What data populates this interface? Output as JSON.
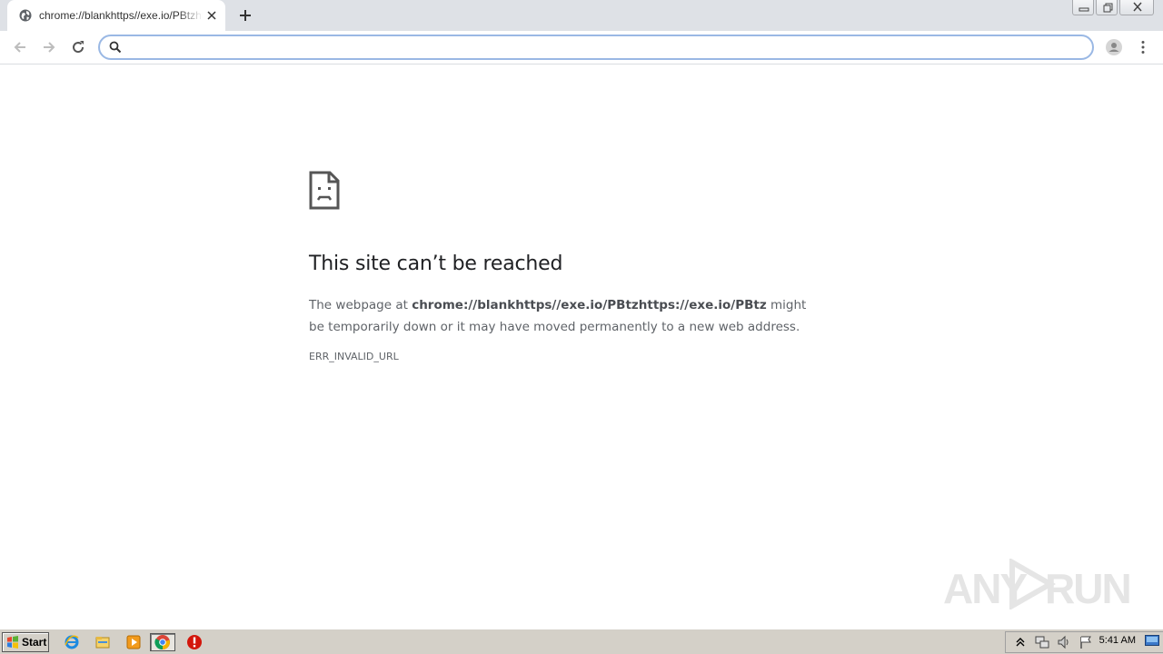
{
  "browser": {
    "tab": {
      "title": "chrome://blankhttps//exe.io/PBtzhttps://exe.io/PBtz",
      "favicon": "globe-icon",
      "close_icon": "close-icon"
    },
    "new_tab_icon": "plus-icon",
    "window_controls": [
      "minimize-icon",
      "restore-icon",
      "close-icon"
    ],
    "toolbar": {
      "back_icon": "arrow-left-icon",
      "forward_icon": "arrow-right-icon",
      "reload_icon": "reload-icon",
      "omnibox": {
        "value": "",
        "icon": "search-icon"
      },
      "profile_icon": "avatar-icon",
      "menu_icon": "kebab-menu-icon"
    }
  },
  "error_page": {
    "icon": "sad-page-icon",
    "title": "This site can’t be reached",
    "body_prefix": "The webpage at ",
    "url": "chrome://blankhttps//exe.io/PBtzhttps://exe.io/PBtz",
    "body_suffix": " might be temporarily down or it may have moved permanently to a new web address.",
    "error_code": "ERR_INVALID_URL"
  },
  "watermark": {
    "text_left": "ANY",
    "text_right": "RUN"
  },
  "taskbar": {
    "start_label": "Start",
    "apps": [
      "ie-icon",
      "explorer-icon",
      "media-player-icon",
      "chrome-icon",
      "stop-icon"
    ],
    "active_app": "chrome-icon",
    "tray_icons": [
      "show-hidden-icon",
      "network-icon",
      "volume-icon",
      "flag-icon"
    ],
    "clock": "5:41 AM"
  },
  "colors": {
    "tabstrip": "#dee1e6",
    "omnibox_border": "#9ab8e4",
    "title_text": "#202124",
    "body_text": "#5f6368",
    "taskbar": "#d4d0c8"
  }
}
